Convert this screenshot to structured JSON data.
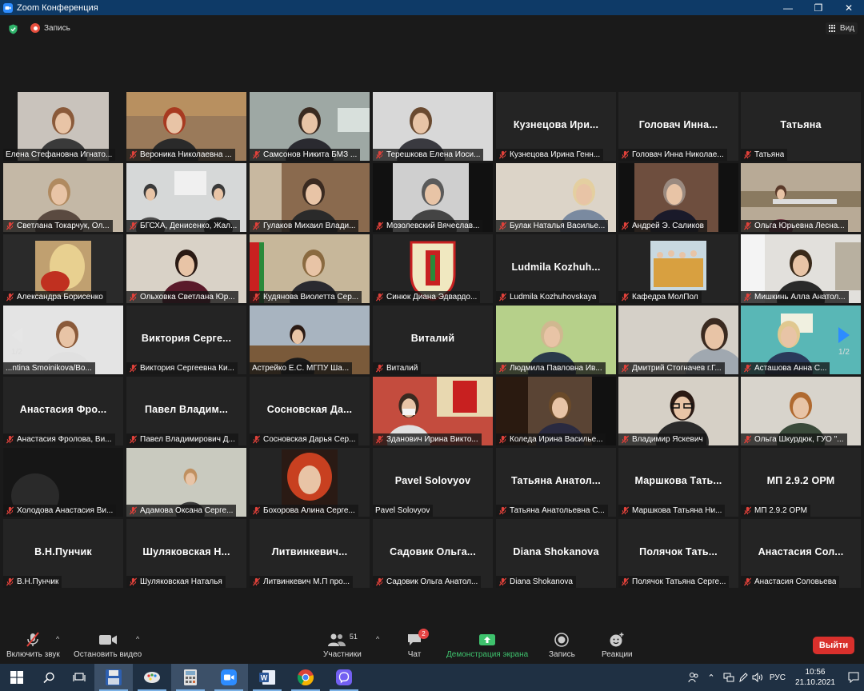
{
  "window": {
    "title": "Zoom Конференция",
    "minimize": "—",
    "maximize": "❐",
    "close": "✕"
  },
  "topbar": {
    "recording_label": "Запись",
    "view_label": "Вид"
  },
  "pager": {
    "left_page": "1/2",
    "right_page": "1/2"
  },
  "tiles": [
    {
      "name": "Елена Стефановна Игнато...",
      "video": true,
      "active": true,
      "muted": false,
      "scene": "woman-light",
      "bg": "#c9c3bc"
    },
    {
      "name": "Вероника Николаевна ...",
      "video": true,
      "muted": true,
      "scene": "redhair",
      "bg": "#9a7a5a"
    },
    {
      "name": "Самсонов Никита БМЗ ...",
      "video": true,
      "muted": true,
      "scene": "man-headset",
      "bg": "#9ea8a4"
    },
    {
      "name": "Терешкова Елена Иоси...",
      "video": true,
      "muted": true,
      "scene": "woman-white",
      "bg": "#d8d8d8"
    },
    {
      "name": "Кузнецова Ирина Генн...",
      "big": "Кузнецова Ири...",
      "video": false,
      "muted": true
    },
    {
      "name": "Головач Инна Николае...",
      "big": "Головач Инна...",
      "video": false,
      "muted": true
    },
    {
      "name": "Татьяна",
      "big": "Татьяна",
      "video": false,
      "muted": true
    },
    {
      "name": "Светлана Токарчук, Ол...",
      "video": true,
      "muted": true,
      "scene": "woman-glasses",
      "bg": "#c4b8a6"
    },
    {
      "name": "БГСХА, Денисенко, Жал...",
      "video": true,
      "muted": true,
      "scene": "office-group",
      "bg": "#d6d8d8"
    },
    {
      "name": "Гулаков Михаил Влади...",
      "video": true,
      "muted": true,
      "scene": "man-office",
      "bg": "#8a6a4e"
    },
    {
      "name": "Мозолевский Вячеслав...",
      "video": true,
      "muted": true,
      "scene": "man-stripe",
      "bg": "#cfcfcf"
    },
    {
      "name": "Булак Наталья Васильe...",
      "video": true,
      "muted": true,
      "scene": "woman-blonde",
      "bg": "#dcd4c8"
    },
    {
      "name": "Андрей Э. Саликов",
      "video": true,
      "muted": true,
      "scene": "man-suit",
      "bg": "#6e4e3e"
    },
    {
      "name": "Ольга Юрьевна Лесна...",
      "video": true,
      "muted": true,
      "scene": "conference-room",
      "bg": "#b8aa96"
    },
    {
      "name": "Александра Борисенко",
      "video": true,
      "muted": true,
      "scene": "blonde-photo",
      "bg": "#2a2a2a"
    },
    {
      "name": "Ольховка Светлана Юр...",
      "video": true,
      "muted": true,
      "scene": "woman-dark",
      "bg": "#d9d2c7"
    },
    {
      "name": "Кудянова Виолетта Сер...",
      "video": true,
      "muted": true,
      "scene": "woman-flag",
      "bg": "#c7b79a"
    },
    {
      "name": "Синюк Диана Эдвардо...",
      "video": true,
      "muted": true,
      "scene": "emblem",
      "bg": "#242424"
    },
    {
      "name": "Ludmila Kozhuhovskaya",
      "big": "Ludmila Kozhuh...",
      "video": false,
      "muted": true
    },
    {
      "name": "Кафедра МолПол",
      "video": true,
      "muted": true,
      "scene": "group-photo",
      "bg": "#242424"
    },
    {
      "name": "Мишкинь Алла Анатол...",
      "video": true,
      "muted": true,
      "scene": "woman-bookshelf",
      "bg": "#e2e0dc"
    },
    {
      "name": "...ntina Smoinikova/Bo...",
      "video": true,
      "muted": false,
      "scene": "woman-portrait",
      "bg": "#e4e4e4"
    },
    {
      "name": "Виктория Сергеевна Ки...",
      "big": "Виктория Серге...",
      "video": false,
      "muted": true
    },
    {
      "name": "Астрейко Е.С. МГПУ Ша...",
      "video": true,
      "muted": false,
      "scene": "woman-room",
      "bg": "#a8b4c0"
    },
    {
      "name": "Виталий",
      "big": "Виталий",
      "video": false,
      "muted": true
    },
    {
      "name": "Людмила Павловна Ив...",
      "video": true,
      "muted": true,
      "scene": "woman-green",
      "bg": "#b6d08a"
    },
    {
      "name": "Дмитрий Стогначев г.Г...",
      "video": true,
      "muted": true,
      "scene": "man-close",
      "bg": "#d5d0c8"
    },
    {
      "name": "Асташова Анна С...",
      "video": true,
      "muted": true,
      "scene": "woman-teal",
      "bg": "#59b7b6"
    },
    {
      "name": "Анастасия Фролова, Ви...",
      "big": "Анастасия Фро...",
      "video": false,
      "muted": true
    },
    {
      "name": "Павел Владимирович Д...",
      "big": "Павел Владим...",
      "video": false,
      "muted": true
    },
    {
      "name": "Сосновская Дарья Сер...",
      "big": "Сосновская Да...",
      "video": false,
      "muted": true
    },
    {
      "name": "Зданович Ирина Викто...",
      "video": true,
      "muted": true,
      "scene": "woman-mask",
      "bg": "#c44c3e"
    },
    {
      "name": "Коледа Ирина Василье...",
      "video": true,
      "muted": true,
      "scene": "woman-bookcase",
      "bg": "#5a4434"
    },
    {
      "name": "Владимир Яскевич",
      "video": true,
      "muted": true,
      "scene": "man-glasses",
      "bg": "#d6d0c6"
    },
    {
      "name": "Ольга Шкурдюк, ГУО \"...",
      "video": true,
      "muted": true,
      "scene": "woman-curly",
      "bg": "#d8d4cc"
    },
    {
      "name": "Холодова Анастасия Ви...",
      "video": true,
      "muted": true,
      "scene": "dark-room",
      "bg": "#161616"
    },
    {
      "name": "Адамова Оксана Серге...",
      "video": true,
      "muted": true,
      "scene": "woman-small",
      "bg": "#c9cabf"
    },
    {
      "name": "Бохорова Алина Серге...",
      "video": true,
      "muted": true,
      "scene": "redhead-photo",
      "bg": "#242424"
    },
    {
      "name": "Pavel Solovyov",
      "big": "Pavel Solovyov",
      "video": false,
      "muted": false
    },
    {
      "name": "Татьяна Анатольевна С...",
      "big": "Татьяна Анатол...",
      "video": false,
      "muted": true
    },
    {
      "name": "Маршкова Татьяна Ни...",
      "big": "Маршкова Тать...",
      "video": false,
      "muted": true
    },
    {
      "name": "МП 2.9.2 ОРМ",
      "big": "МП 2.9.2 ОРМ",
      "video": false,
      "muted": true
    },
    {
      "name": "В.Н.Пунчик",
      "big": "В.Н.Пунчик",
      "video": false,
      "muted": true
    },
    {
      "name": "Шуляковская Наталья",
      "big": "Шуляковская Н...",
      "video": false,
      "muted": true
    },
    {
      "name": "Литвинкевич М.П   про...",
      "big": "Литвинкевич...",
      "video": false,
      "muted": true
    },
    {
      "name": "Садовик Ольга Анатол...",
      "big": "Садовик Ольга...",
      "video": false,
      "muted": true
    },
    {
      "name": "Diana Shokanova",
      "big": "Diana Shokanova",
      "video": false,
      "muted": true
    },
    {
      "name": "Полячок Татьяна Серге...",
      "big": "Полячок Тать...",
      "video": false,
      "muted": true
    },
    {
      "name": "Анастасия Соловьева",
      "big": "Анастасия Сол...",
      "video": false,
      "muted": true
    }
  ],
  "toolbar": {
    "unmute": "Включить звук",
    "start_video": "Остановить видео",
    "participants": "Участники",
    "participants_count": "51",
    "chat": "Чат",
    "chat_badge": "2",
    "share": "Демонстрация экрана",
    "record": "Запись",
    "reactions": "Реакции",
    "leave": "Выйти"
  },
  "taskbar": {
    "lang": "РУС",
    "time": "10:56",
    "date": "21.10.2021"
  },
  "colors": {
    "active_speaker": "#d8e672",
    "share_green": "#3ec26d",
    "leave_red": "#d9302c",
    "mute_red": "#e0413a"
  }
}
